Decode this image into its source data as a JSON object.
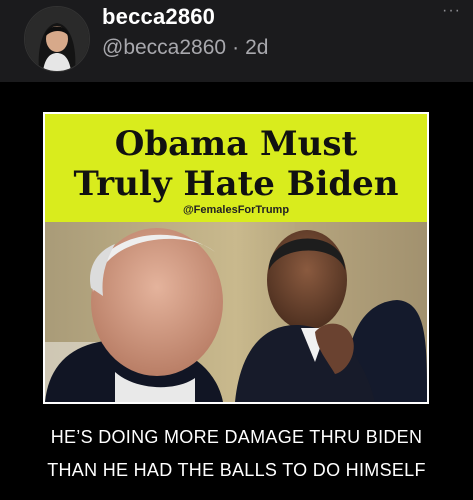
{
  "post": {
    "author": {
      "username": "becca2860",
      "handle": "@becca2860",
      "time": "2d",
      "separator": "·"
    },
    "more_label": "···"
  },
  "meme": {
    "headline_line1": "Obama Must",
    "headline_line2": "Truly Hate Biden",
    "watermark": "@FemalesForTrump",
    "panel_color": "#d9ec1d",
    "caption_line1": "HE’S DOING MORE DAMAGE THRU BIDEN",
    "caption_line2": "THAN HE HAD THE BALLS TO DO HIMSELF"
  }
}
